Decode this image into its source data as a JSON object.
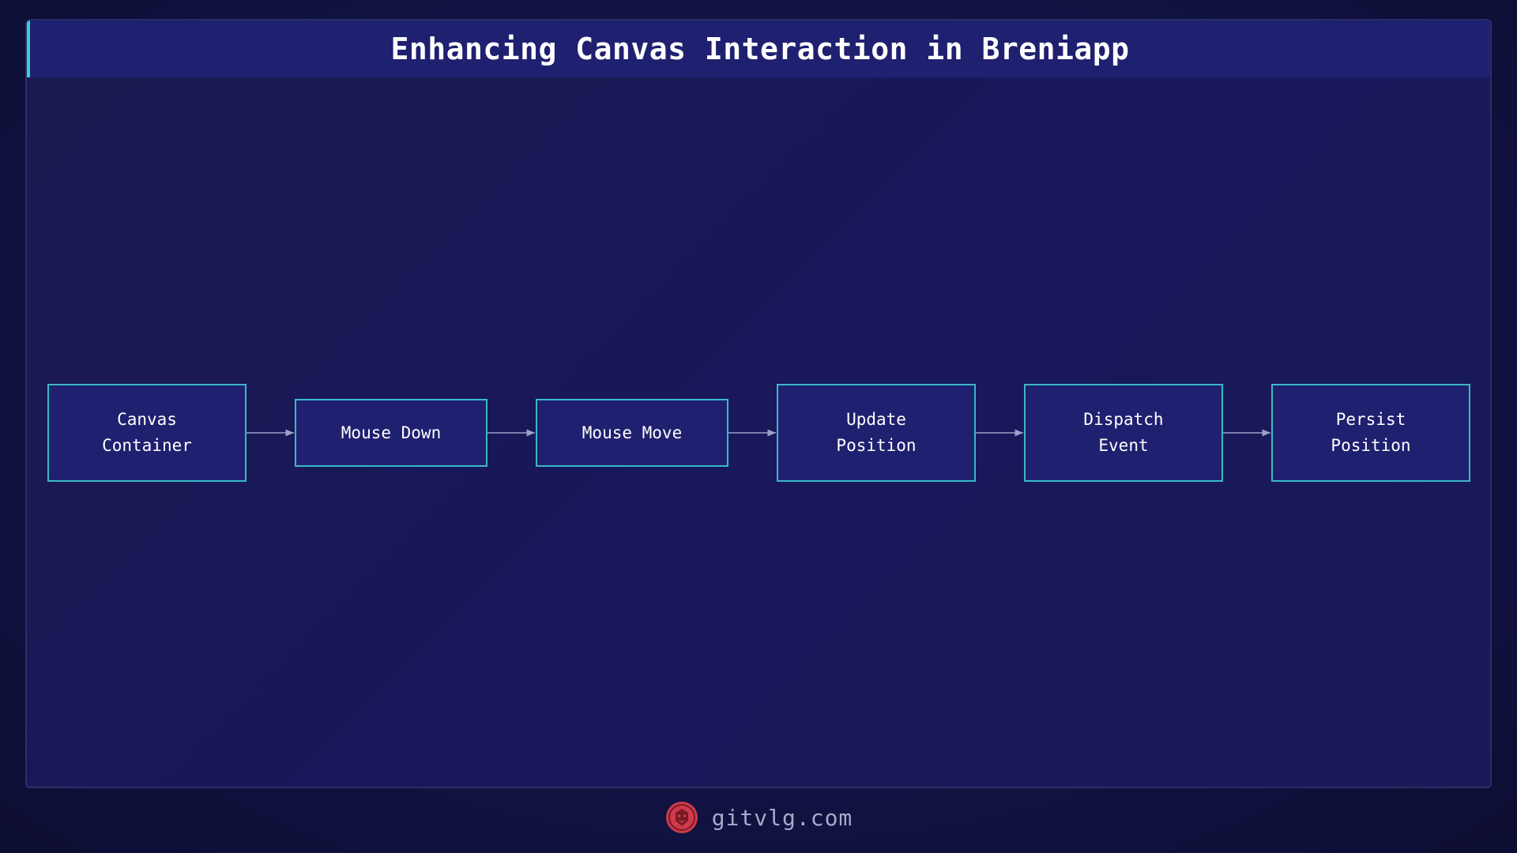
{
  "title": "Enhancing Canvas Interaction in Breniapp",
  "nodes": [
    {
      "id": "canvas-container",
      "label": "Canvas\nContainer"
    },
    {
      "id": "mouse-down",
      "label": "Mouse Down"
    },
    {
      "id": "mouse-move",
      "label": "Mouse Move"
    },
    {
      "id": "update-position",
      "label": "Update\nPosition"
    },
    {
      "id": "dispatch-event",
      "label": "Dispatch\nEvent"
    },
    {
      "id": "persist-position",
      "label": "Persist\nPosition"
    }
  ],
  "edges": [
    {
      "from": "canvas-container",
      "to": "mouse-down"
    },
    {
      "from": "mouse-down",
      "to": "mouse-move"
    },
    {
      "from": "mouse-move",
      "to": "update-position"
    },
    {
      "from": "update-position",
      "to": "dispatch-event"
    },
    {
      "from": "dispatch-event",
      "to": "persist-position"
    }
  ],
  "footer": {
    "text": "gitvlg.com",
    "logo_icon": "lion-icon"
  },
  "colors": {
    "background": "#0f1036",
    "panel": "#1a1a55",
    "node_fill": "#202070",
    "node_border": "#3ab8c8",
    "accent": "#3ad0d8",
    "arrow": "#9aa0c8",
    "logo": "#d03a4a"
  }
}
